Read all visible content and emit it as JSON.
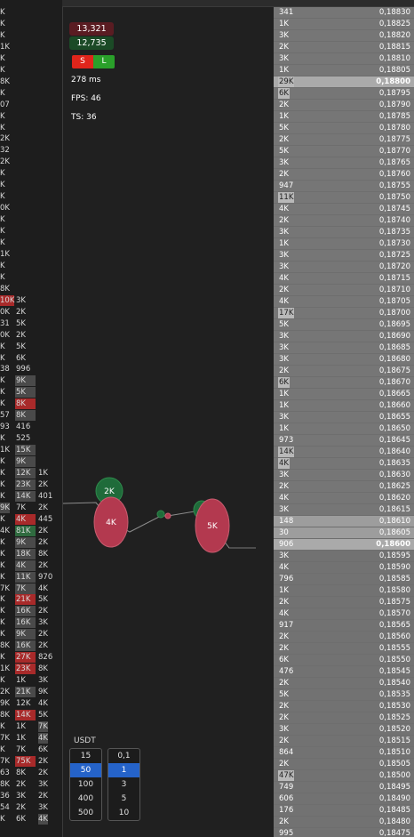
{
  "header": {
    "bar": ""
  },
  "stats": {
    "pnl_top": "13,321",
    "pnl_bottom": "12,735",
    "short_label": "S",
    "long_label": "L",
    "latency": "278 ms",
    "fps": "FPS: 46",
    "ts": "TS: 36"
  },
  "bubbles": [
    {
      "label": "2K",
      "side": "buy"
    },
    {
      "label": "4K",
      "side": "sell"
    },
    {
      "label": "",
      "side": "buy"
    },
    {
      "label": "",
      "side": "sell"
    },
    {
      "label": "",
      "side": "buy"
    },
    {
      "label": "5K",
      "side": "sell"
    }
  ],
  "usdt": {
    "label": "USDT",
    "amounts": [
      "15",
      "50",
      "100",
      "400",
      "500"
    ],
    "amount_selected": "50",
    "multipliers": [
      "0,1",
      "1",
      "3",
      "5",
      "10"
    ],
    "multiplier_selected": "1"
  },
  "left_trades": [
    {
      "c1": "K",
      "c2": "",
      "c3": ""
    },
    {
      "c1": "K",
      "c2": "",
      "c3": ""
    },
    {
      "c1": "K",
      "c2": "",
      "c3": ""
    },
    {
      "c1": "1K",
      "c2": "",
      "c3": ""
    },
    {
      "c1": "K",
      "c2": "",
      "c3": ""
    },
    {
      "c1": "K",
      "c2": "",
      "c3": ""
    },
    {
      "c1": "8K",
      "c2": "",
      "c3": ""
    },
    {
      "c1": "K",
      "c2": "",
      "c3": ""
    },
    {
      "c1": "07",
      "c2": "",
      "c3": ""
    },
    {
      "c1": "K",
      "c2": "",
      "c3": ""
    },
    {
      "c1": "K",
      "c2": "",
      "c3": ""
    },
    {
      "c1": "2K",
      "c2": "",
      "c3": ""
    },
    {
      "c1": "32",
      "c2": "",
      "c3": ""
    },
    {
      "c1": "2K",
      "c2": "",
      "c3": ""
    },
    {
      "c1": "K",
      "c2": "",
      "c3": ""
    },
    {
      "c1": "K",
      "c2": "",
      "c3": ""
    },
    {
      "c1": "K",
      "c2": "",
      "c3": ""
    },
    {
      "c1": "0K",
      "c2": "",
      "c3": ""
    },
    {
      "c1": "K",
      "c2": "",
      "c3": ""
    },
    {
      "c1": "K",
      "c2": "",
      "c3": ""
    },
    {
      "c1": "K",
      "c2": "",
      "c3": ""
    },
    {
      "c1": "1K",
      "c2": "",
      "c3": ""
    },
    {
      "c1": "K",
      "c2": "",
      "c3": ""
    },
    {
      "c1": "K",
      "c2": "",
      "c3": ""
    },
    {
      "c1": "8K",
      "c2": "",
      "c3": ""
    },
    {
      "c1": "10K",
      "c2": "3K",
      "c3": "",
      "c1c": "red"
    },
    {
      "c1": "0K",
      "c2": "2K",
      "c3": ""
    },
    {
      "c1": "31",
      "c2": "5K",
      "c3": ""
    },
    {
      "c1": "0K",
      "c2": "2K",
      "c3": ""
    },
    {
      "c1": "K",
      "c2": "5K",
      "c3": ""
    },
    {
      "c1": "K",
      "c2": "6K",
      "c3": ""
    },
    {
      "c1": "38",
      "c2": "996",
      "c3": ""
    },
    {
      "c1": "K",
      "c2": "9K",
      "c3": "",
      "c2c": "grey"
    },
    {
      "c1": "K",
      "c2": "5K",
      "c3": "",
      "c2c": "grey"
    },
    {
      "c1": "K",
      "c2": "8K",
      "c3": "",
      "c2c": "red"
    },
    {
      "c1": "57",
      "c2": "8K",
      "c3": "",
      "c2c": "grey"
    },
    {
      "c1": "93",
      "c2": "416",
      "c3": ""
    },
    {
      "c1": "K",
      "c2": "525",
      "c3": ""
    },
    {
      "c1": "1K",
      "c2": "15K",
      "c3": "",
      "c2c": "grey"
    },
    {
      "c1": "K",
      "c2": "9K",
      "c3": "",
      "c2c": "grey"
    },
    {
      "c1": "K",
      "c2": "12K",
      "c3": "1K",
      "c2c": "grey"
    },
    {
      "c1": "K",
      "c2": "23K",
      "c3": "2K",
      "c2c": "grey"
    },
    {
      "c1": "K",
      "c2": "14K",
      "c3": "401",
      "c2c": "grey"
    },
    {
      "c1": "9K",
      "c2": "7K",
      "c3": "2K",
      "c1c": "grey"
    },
    {
      "c1": "K",
      "c2": "4K",
      "c3": "445",
      "c2c": "red"
    },
    {
      "c1": "4K",
      "c2": "81K",
      "c3": "2K",
      "c2c": "green"
    },
    {
      "c1": "K",
      "c2": "9K",
      "c3": "2K",
      "c2c": "grey"
    },
    {
      "c1": "K",
      "c2": "18K",
      "c3": "8K",
      "c2c": "grey"
    },
    {
      "c1": "K",
      "c2": "4K",
      "c3": "2K",
      "c2c": "grey"
    },
    {
      "c1": "K",
      "c2": "11K",
      "c3": "970",
      "c2c": "grey"
    },
    {
      "c1": "7K",
      "c2": "7K",
      "c3": "4K",
      "c2c": "grey"
    },
    {
      "c1": "K",
      "c2": "21K",
      "c3": "5K",
      "c2c": "red"
    },
    {
      "c1": "K",
      "c2": "16K",
      "c3": "2K",
      "c2c": "grey"
    },
    {
      "c1": "K",
      "c2": "16K",
      "c3": "3K",
      "c2c": "grey"
    },
    {
      "c1": "K",
      "c2": "9K",
      "c3": "2K",
      "c2c": "grey"
    },
    {
      "c1": "8K",
      "c2": "16K",
      "c3": "2K",
      "c2c": "grey"
    },
    {
      "c1": "K",
      "c2": "27K",
      "c3": "826",
      "c2c": "red"
    },
    {
      "c1": "1K",
      "c2": "23K",
      "c3": "8K",
      "c2c": "red"
    },
    {
      "c1": "K",
      "c2": "1K",
      "c3": "3K"
    },
    {
      "c1": "2K",
      "c2": "21K",
      "c3": "9K",
      "c2c": "grey"
    },
    {
      "c1": "9K",
      "c2": "12K",
      "c3": "4K"
    },
    {
      "c1": "8K",
      "c2": "14K",
      "c3": "5K",
      "c2c": "red"
    },
    {
      "c1": "K",
      "c2": "1K",
      "c3": "7K",
      "c3c": "grey"
    },
    {
      "c1": "7K",
      "c2": "1K",
      "c3": "4K",
      "c3c": "grey"
    },
    {
      "c1": "K",
      "c2": "7K",
      "c3": "6K"
    },
    {
      "c1": "7K",
      "c2": "75K",
      "c3": "2K",
      "c2c": "red"
    },
    {
      "c1": "63",
      "c2": "8K",
      "c3": "2K"
    },
    {
      "c1": "8K",
      "c2": "2K",
      "c3": "3K"
    },
    {
      "c1": "36",
      "c2": "3K",
      "c3": "2K"
    },
    {
      "c1": "54",
      "c2": "2K",
      "c3": "3K"
    },
    {
      "c1": "K",
      "c2": "6K",
      "c3": "4K",
      "c3c": "grey"
    }
  ],
  "ladder": [
    {
      "vol": "341",
      "price": "0,18830",
      "side": "ask"
    },
    {
      "vol": "1K",
      "price": "0,18825",
      "side": "ask"
    },
    {
      "vol": "3K",
      "price": "0,18820",
      "side": "ask"
    },
    {
      "vol": "2K",
      "price": "0,18815",
      "side": "ask"
    },
    {
      "vol": "3K",
      "price": "0,18810",
      "side": "ask"
    },
    {
      "vol": "1K",
      "price": "0,18805",
      "side": "ask"
    },
    {
      "vol": "29K",
      "price": "0,18800",
      "side": "ask",
      "hl": true,
      "bar": true
    },
    {
      "vol": "6K",
      "price": "0,18795",
      "side": "ask",
      "bar": true
    },
    {
      "vol": "2K",
      "price": "0,18790",
      "side": "ask"
    },
    {
      "vol": "1K",
      "price": "0,18785",
      "side": "ask"
    },
    {
      "vol": "5K",
      "price": "0,18780",
      "side": "ask"
    },
    {
      "vol": "2K",
      "price": "0,18775",
      "side": "ask"
    },
    {
      "vol": "5K",
      "price": "0,18770",
      "side": "ask"
    },
    {
      "vol": "3K",
      "price": "0,18765",
      "side": "ask"
    },
    {
      "vol": "2K",
      "price": "0,18760",
      "side": "ask"
    },
    {
      "vol": "947",
      "price": "0,18755",
      "side": "ask"
    },
    {
      "vol": "11K",
      "price": "0,18750",
      "side": "ask",
      "bar": true
    },
    {
      "vol": "4K",
      "price": "0,18745",
      "side": "ask"
    },
    {
      "vol": "2K",
      "price": "0,18740",
      "side": "ask"
    },
    {
      "vol": "3K",
      "price": "0,18735",
      "side": "ask"
    },
    {
      "vol": "1K",
      "price": "0,18730",
      "side": "ask"
    },
    {
      "vol": "3K",
      "price": "0,18725",
      "side": "ask"
    },
    {
      "vol": "3K",
      "price": "0,18720",
      "side": "ask"
    },
    {
      "vol": "4K",
      "price": "0,18715",
      "side": "ask"
    },
    {
      "vol": "2K",
      "price": "0,18710",
      "side": "ask"
    },
    {
      "vol": "4K",
      "price": "0,18705",
      "side": "ask"
    },
    {
      "vol": "17K",
      "price": "0,18700",
      "side": "ask",
      "bar": true
    },
    {
      "vol": "5K",
      "price": "0,18695",
      "side": "ask"
    },
    {
      "vol": "3K",
      "price": "0,18690",
      "side": "ask"
    },
    {
      "vol": "3K",
      "price": "0,18685",
      "side": "ask"
    },
    {
      "vol": "3K",
      "price": "0,18680",
      "side": "ask"
    },
    {
      "vol": "2K",
      "price": "0,18675",
      "side": "ask"
    },
    {
      "vol": "6K",
      "price": "0,18670",
      "side": "ask",
      "bar": true
    },
    {
      "vol": "1K",
      "price": "0,18665",
      "side": "ask"
    },
    {
      "vol": "1K",
      "price": "0,18660",
      "side": "ask"
    },
    {
      "vol": "3K",
      "price": "0,18655",
      "side": "ask"
    },
    {
      "vol": "1K",
      "price": "0,18650",
      "side": "ask"
    },
    {
      "vol": "973",
      "price": "0,18645",
      "side": "ask"
    },
    {
      "vol": "14K",
      "price": "0,18640",
      "side": "ask",
      "bar": true
    },
    {
      "vol": "4K",
      "price": "0,18635",
      "side": "ask",
      "bar": true
    },
    {
      "vol": "3K",
      "price": "0,18630",
      "side": "ask"
    },
    {
      "vol": "2K",
      "price": "0,18625",
      "side": "ask"
    },
    {
      "vol": "4K",
      "price": "0,18620",
      "side": "ask"
    },
    {
      "vol": "3K",
      "price": "0,18615",
      "side": "ask"
    },
    {
      "vol": "148",
      "price": "0,18610",
      "side": "ask",
      "lt": true
    },
    {
      "vol": "30",
      "price": "0,18605",
      "side": "ask",
      "lt": true
    },
    {
      "vol": "906",
      "price": "0,18600",
      "side": "bid",
      "hl": true
    },
    {
      "vol": "3K",
      "price": "0,18595",
      "side": "bid"
    },
    {
      "vol": "4K",
      "price": "0,18590",
      "side": "bid"
    },
    {
      "vol": "796",
      "price": "0,18585",
      "side": "bid"
    },
    {
      "vol": "1K",
      "price": "0,18580",
      "side": "bid"
    },
    {
      "vol": "2K",
      "price": "0,18575",
      "side": "bid"
    },
    {
      "vol": "4K",
      "price": "0,18570",
      "side": "bid"
    },
    {
      "vol": "917",
      "price": "0,18565",
      "side": "bid"
    },
    {
      "vol": "2K",
      "price": "0,18560",
      "side": "bid"
    },
    {
      "vol": "2K",
      "price": "0,18555",
      "side": "bid"
    },
    {
      "vol": "6K",
      "price": "0,18550",
      "side": "bid"
    },
    {
      "vol": "476",
      "price": "0,18545",
      "side": "bid"
    },
    {
      "vol": "2K",
      "price": "0,18540",
      "side": "bid"
    },
    {
      "vol": "5K",
      "price": "0,18535",
      "side": "bid"
    },
    {
      "vol": "2K",
      "price": "0,18530",
      "side": "bid"
    },
    {
      "vol": "2K",
      "price": "0,18525",
      "side": "bid"
    },
    {
      "vol": "3K",
      "price": "0,18520",
      "side": "bid"
    },
    {
      "vol": "2K",
      "price": "0,18515",
      "side": "bid"
    },
    {
      "vol": "864",
      "price": "0,18510",
      "side": "bid"
    },
    {
      "vol": "2K",
      "price": "0,18505",
      "side": "bid"
    },
    {
      "vol": "47K",
      "price": "0,18500",
      "side": "bid",
      "bar": true
    },
    {
      "vol": "749",
      "price": "0,18495",
      "side": "bid"
    },
    {
      "vol": "606",
      "price": "0,18490",
      "side": "bid"
    },
    {
      "vol": "176",
      "price": "0,18485",
      "side": "bid"
    },
    {
      "vol": "2K",
      "price": "0,18480",
      "side": "bid"
    },
    {
      "vol": "995",
      "price": "0,18475",
      "side": "bid"
    }
  ]
}
